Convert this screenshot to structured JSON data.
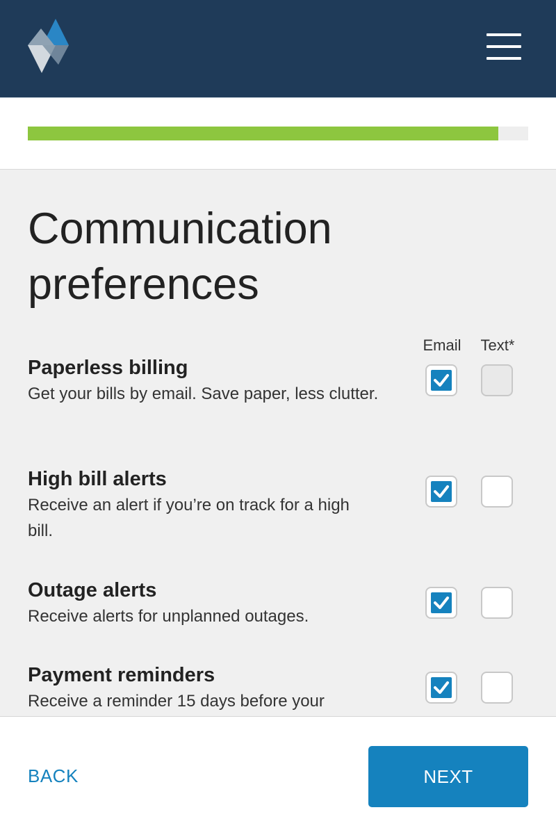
{
  "header": {
    "logo_icon": "diamond-logo-icon",
    "menu_icon": "hamburger-menu-icon",
    "background_color": "#1f3b59"
  },
  "progress": {
    "fraction_complete": 0.94,
    "fill_color": "#8dc63f"
  },
  "page": {
    "title": "Communication preferences"
  },
  "columns": {
    "email": "Email",
    "text": "Text*"
  },
  "preferences": [
    {
      "title": "Paperless billing",
      "description": "Get your bills by email. Save paper, less clutter.",
      "email_checked": true,
      "text_checked": false,
      "text_disabled": true
    },
    {
      "title": "High bill alerts",
      "description": "Receive an alert if you’re on track for a high bill.",
      "email_checked": true,
      "text_checked": false,
      "text_disabled": false
    },
    {
      "title": "Outage alerts",
      "description": "Receive alerts for unplanned outages.",
      "email_checked": true,
      "text_checked": false,
      "text_disabled": false
    },
    {
      "title": "Payment reminders",
      "description": "Receive a reminder 15 days before your",
      "email_checked": true,
      "text_checked": false,
      "text_disabled": false
    }
  ],
  "footer": {
    "back_label": "BACK",
    "next_label": "NEXT",
    "accent_color": "#1582be"
  }
}
